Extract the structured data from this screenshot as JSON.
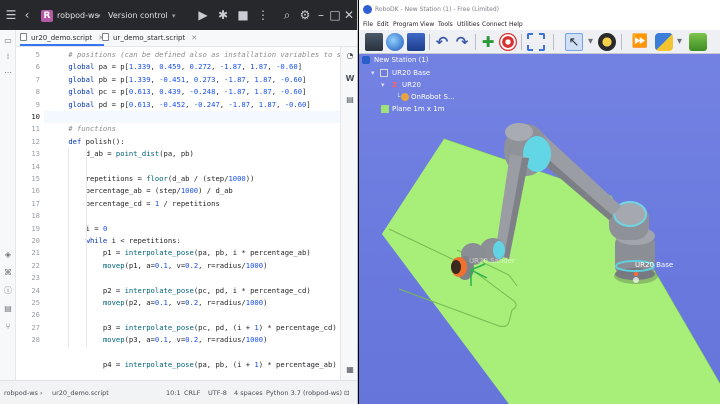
{
  "ide": {
    "project_badge": "R",
    "project_name": "robpod-ws",
    "vcs_label": "Version control",
    "tabs": [
      {
        "label": "ur20_demo.script",
        "active": true
      },
      {
        "label": "ur_demo_start.script",
        "active": false
      }
    ],
    "line_numbers": [
      "5",
      "6",
      "7",
      "8",
      "9",
      "10",
      "11",
      "12",
      "13",
      "14",
      "15",
      "16",
      "17",
      "18",
      "19",
      "20",
      "21",
      "22",
      "23",
      "24",
      "25",
      "26",
      "27",
      "28"
    ],
    "code_lines": [
      "    # positions (can be defined also as installation variables to st",
      "    global pa = p[1.339, 0.459, 0.272, -1.87, 1.87, -0.60]",
      "    global pb = p[1.339, -0.451, 0.273, -1.87, 1.87, -0.60]",
      "    global pc = p[0.613, 0.439, -0.248, -1.87, 1.87, -0.60]",
      "    global pd = p[0.613, -0.452, -0.247, -1.87, 1.87, -0.60]",
      "",
      "    # functions",
      "    def polish():",
      "        d_ab = point_dist(pa, pb)",
      "",
      "        repetitions = floor(d_ab / (step/1000))",
      "        percentage_ab = (step/1000) / d_ab",
      "        percentage_cd = 1 / repetitions",
      "",
      "        i = 0",
      "        while i < repetitions:",
      "            p1 = interpolate_pose(pa, pb, i * percentage_ab)",
      "            movep(p1, a=0.1, v=0.2, r=radius/1000)",
      "",
      "            p2 = interpolate_pose(pc, pd, i * percentage_cd)",
      "            movep(p2, a=0.1, v=0.2, r=radius/1000)",
      "",
      "            p3 = interpolate_pose(pc, pd, (i + 1) * percentage_cd)",
      "            movep(p3, a=0.1, v=0.2, r=radius/1000)",
      "",
      "            p4 = interpolate_pose(pa, pb, (i + 1) * percentage_ab)"
    ],
    "status": {
      "path_root": "robpod-ws",
      "path_file": "ur20_demo.script",
      "position": "10:1",
      "line_sep": "CRLF",
      "encoding": "UTF-8",
      "indent": "4 spaces",
      "interpreter": "Python 3.7 (robpod-ws)"
    }
  },
  "robodk": {
    "title": "RoboDK - New Station (1) - Free (Limited)",
    "menu": [
      "File",
      "Edit",
      "Program",
      "View",
      "Tools",
      "Utilities",
      "Connect",
      "Help"
    ],
    "tree": {
      "station": "New Station (1)",
      "base": "UR20 Base",
      "robot": "UR20",
      "tool": "OnRobot S...",
      "plane": "Plane 1m x 1m"
    },
    "scene_labels": {
      "base": "UR20 Base",
      "tool": "UR20 Sander"
    },
    "colors": {
      "background": "#6d7ce0",
      "plane": "#a8f07a",
      "robot_gray": "#8d9096",
      "joint_cyan": "#67d8e6"
    }
  }
}
